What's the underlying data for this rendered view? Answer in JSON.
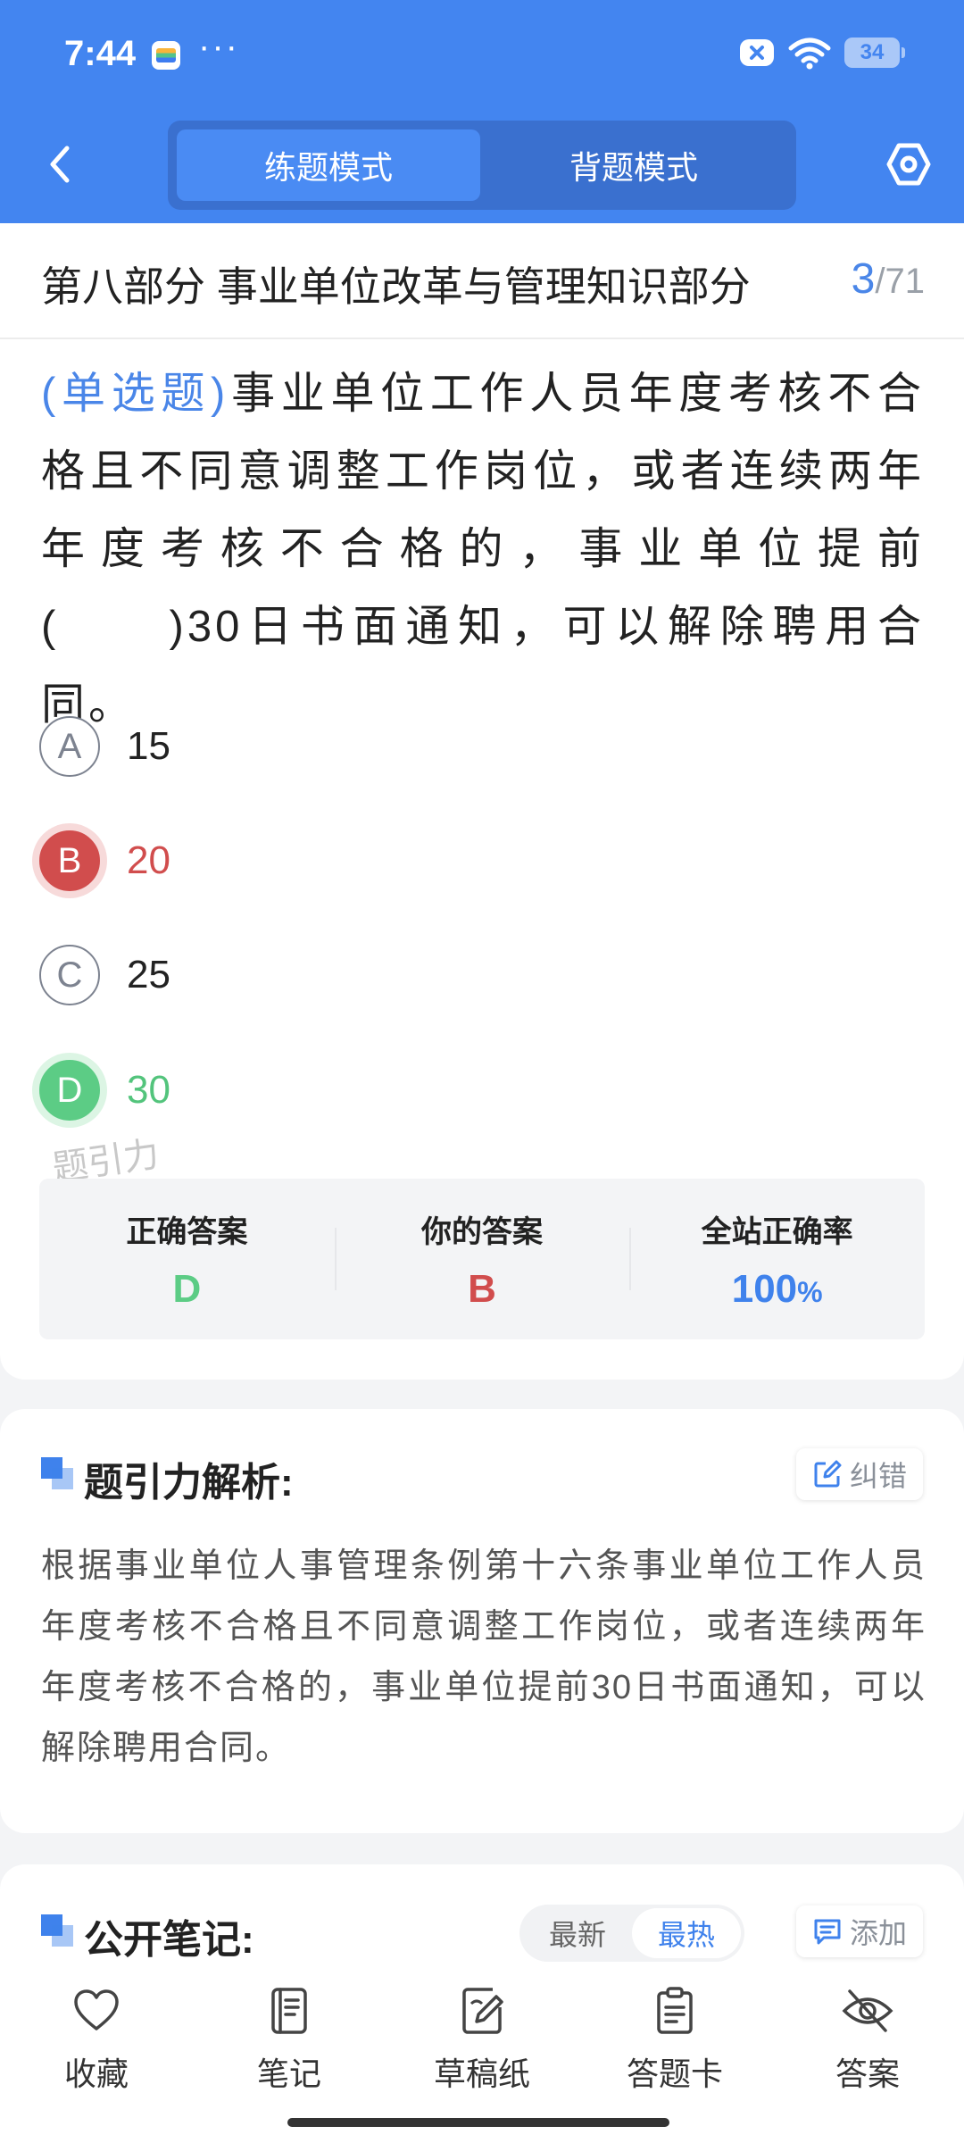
{
  "status_bar": {
    "time": "7:44",
    "dots": "···",
    "battery": "34"
  },
  "header": {
    "back_icon": "chevron-left-icon",
    "mode_tabs": [
      {
        "label": "练题模式",
        "active": true
      },
      {
        "label": "背题模式",
        "active": false
      }
    ],
    "settings_icon": "hexagon-gear-icon"
  },
  "question": {
    "section_title": "第八部分 事业单位改革与管理知识部分",
    "current": "3",
    "separator": "/",
    "total": "71",
    "type_label": "(单选题)",
    "text": "事业单位工作人员年度考核不合格且不同意调整工作岗位，或者连续两年年度考核不合格的，事业单位提前(　　)30日书面通知，可以解除聘用合同。",
    "options": [
      {
        "letter": "A",
        "text": "15",
        "state": "normal"
      },
      {
        "letter": "B",
        "text": "20",
        "state": "wrong"
      },
      {
        "letter": "C",
        "text": "25",
        "state": "normal"
      },
      {
        "letter": "D",
        "text": "30",
        "state": "correct"
      }
    ],
    "watermark": "题引力"
  },
  "stats": {
    "correct_label": "正确答案",
    "correct_value": "D",
    "yours_label": "你的答案",
    "yours_value": "B",
    "rate_label": "全站正确率",
    "rate_value": "100",
    "rate_unit": "%"
  },
  "analysis": {
    "title": "题引力解析:",
    "report_label": "纠错",
    "text": "根据事业单位人事管理条例第十六条事业单位工作人员年度考核不合格且不同意调整工作岗位，或者连续两年年度考核不合格的，事业单位提前30日书面通知，可以解除聘用合同。"
  },
  "notes": {
    "title": "公开笔记:",
    "sort_options": [
      {
        "label": "最新",
        "active": false
      },
      {
        "label": "最热",
        "active": true
      }
    ],
    "add_label": "添加"
  },
  "bottom_nav": [
    {
      "label": "收藏",
      "icon": "heart-icon"
    },
    {
      "label": "笔记",
      "icon": "notebook-icon"
    },
    {
      "label": "草稿纸",
      "icon": "draft-paper-icon"
    },
    {
      "label": "答题卡",
      "icon": "answer-card-icon"
    },
    {
      "label": "答案",
      "icon": "eye-off-icon"
    }
  ],
  "colors": {
    "primary": "#4385f0",
    "accent_blue": "#3f82ec",
    "wrong_red": "#d14d4d",
    "correct_green": "#5ccc85"
  }
}
